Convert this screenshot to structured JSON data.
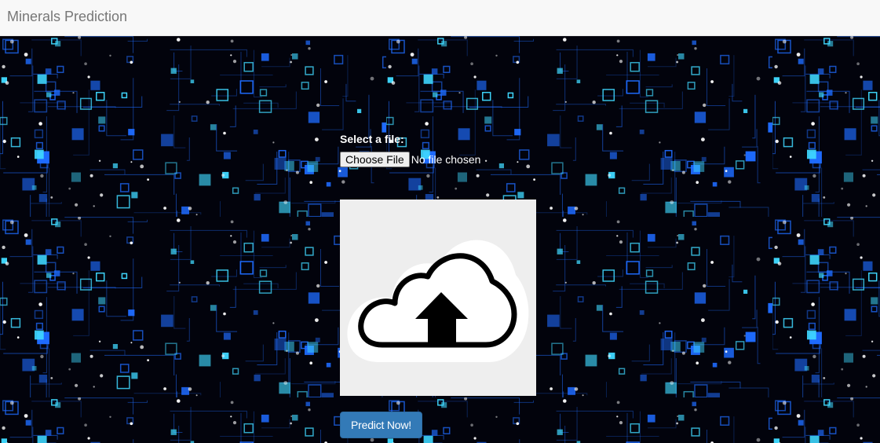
{
  "navbar": {
    "brand": "Minerals Prediction"
  },
  "form": {
    "file_label": "Select a file:",
    "choose_button": "Choose File",
    "file_status": "No file chosen",
    "preview_icon": "cloud-upload-icon",
    "predict_button": "Predict Now!"
  },
  "background": {
    "icon": "circuit-board-pattern",
    "base_color": "#02030c",
    "accent_color": "#1e6bff",
    "glow_color": "#3fd8ff"
  },
  "colors": {
    "navbar_bg": "#f8f8f8",
    "brand_text": "#777777",
    "primary_button": "#337ab7",
    "preview_bg": "#eeeeee"
  }
}
